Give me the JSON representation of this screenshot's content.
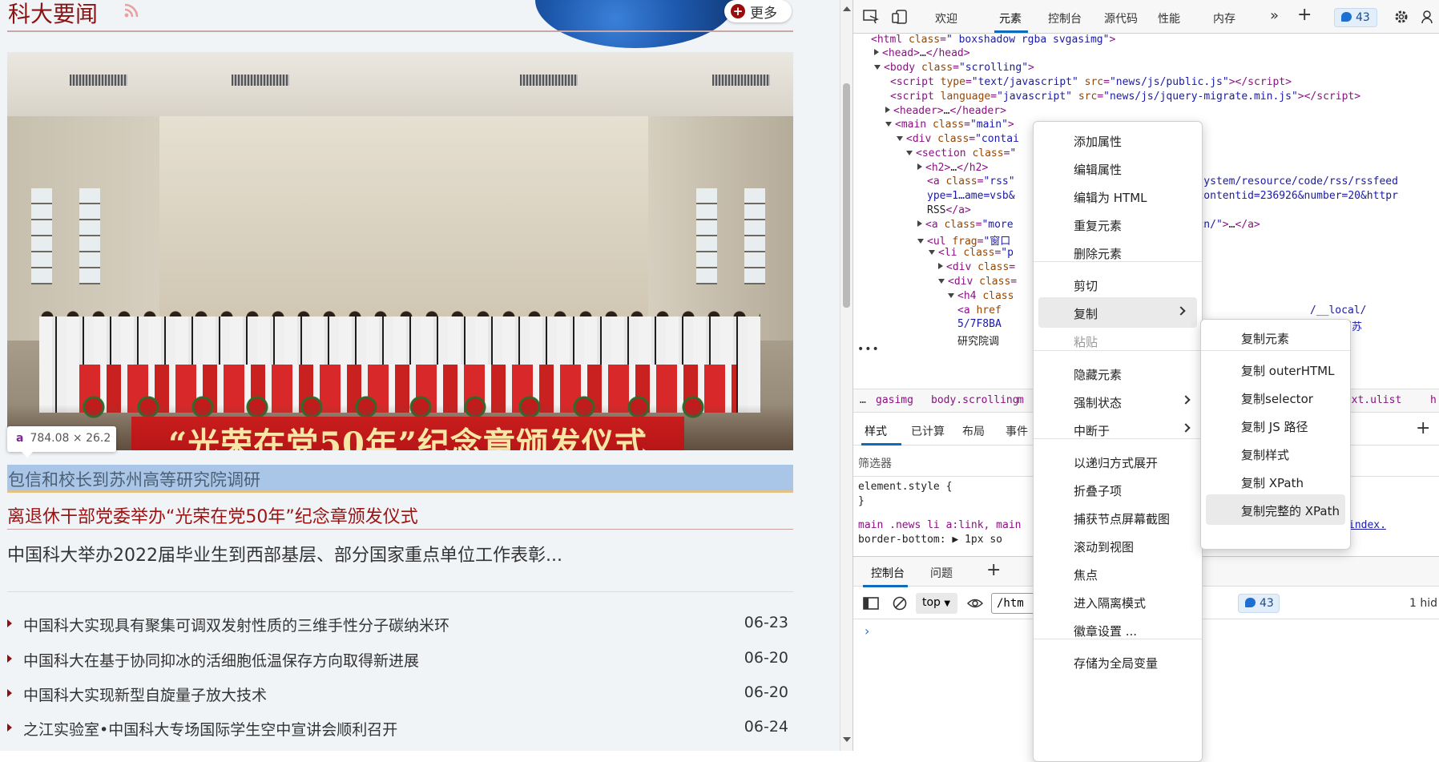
{
  "page": {
    "section_title": "科大要闻",
    "more_label": "更多",
    "photo_banner": "“光荣在党50年”纪念章颁发仪式",
    "size_tip": {
      "tag": "a",
      "size": "784.08 × 26.2"
    },
    "highlight_link": "包信和校长到苏州高等研究院调研",
    "news_1": "离退休干部党委举办“光荣在党50年”纪念章颁发仪式",
    "news_2": "中国科大举办2022届毕业生到西部基层、部分国家重点单位工作表彰...",
    "list": [
      {
        "title": "中国科大实现具有聚集可调双发射性质的三维手性分子碳纳米环",
        "date": "06-23"
      },
      {
        "title": "中国科大在基于协同抑冰的活细胞低温保存方向取得新进展",
        "date": "06-20"
      },
      {
        "title": "中国科大实现新型自旋量子放大技术",
        "date": "06-20"
      },
      {
        "title": "之江实验室•中国科大专场国际学生空中宣讲会顺利召开",
        "date": "06-24"
      }
    ]
  },
  "devtools": {
    "tabs": [
      "欢迎",
      "元素",
      "控制台",
      "源代码",
      "性能",
      "内存"
    ],
    "issues_count": "43",
    "dom": [
      {
        "html": "<span class='tg'>&lt;html</span> <span class='at'>class</span>=<span class='vl'>\" boxshadow rgba svgasimg\"</span><span class='tg'>&gt;</span>"
      },
      {
        "html": "<span class='tri tri-r'></span><span class='tg'>&lt;head&gt;</span><span class='tx'>…</span><span class='tg'>&lt;/head&gt;</span>"
      },
      {
        "html": "<span class='tri tri-d'></span><span class='tg'>&lt;body</span> <span class='at'>class</span>=<span class='vl'>\"scrolling\"</span><span class='tg'>&gt;</span>"
      },
      {
        "html": "<span class='tg'>&lt;script</span> <span class='at'>type</span>=<span class='vl'>\"text/javascript\"</span> <span class='at'>src</span>=<span class='vl'>\"news/js/public.js\"</span><span class='tg'>&gt;&lt;/script&gt;</span>"
      },
      {
        "html": "<span class='tg'>&lt;script</span> <span class='at'>language</span>=<span class='vl'>\"javascript\"</span> <span class='at'>src</span>=<span class='vl'>\"news/js/jquery-migrate.min.js\"</span><span class='tg'>&gt;&lt;/script&gt;</span>"
      },
      {
        "html": "<span class='tri tri-r'></span><span class='tg'>&lt;header&gt;</span><span class='tx'>…</span><span class='tg'>&lt;/header&gt;</span>"
      },
      {
        "html": "<span class='tri tri-d'></span><span class='tg'>&lt;main</span> <span class='at'>class</span>=<span class='vl'>\"main\"</span><span class='tg'>&gt;</span>"
      },
      {
        "html": "<span class='tri tri-d'></span><span class='tg'>&lt;div</span> <span class='at'>class</span>=<span class='vl'>\"contai</span>"
      },
      {
        "html": "<span class='tri tri-d'></span><span class='tg'>&lt;section</span> <span class='at'>class</span>=<span class='vl'>\"</span>"
      },
      {
        "html": "<span class='tri tri-r'></span><span class='tg'>&lt;h2&gt;</span><span class='tx'>…</span><span class='tg'>&lt;/h2&gt;</span>"
      },
      {
        "html": "<span class='tg'>&lt;a</span> <span class='at'>class</span>=<span class='vl'>\"rss\"</span>"
      },
      {
        "html": "<span class='vl'>ype=1…ame=vsb&amp;</span>"
      },
      {
        "html": "<span class='tx'>RSS</span><span class='tg'>&lt;/a&gt;</span>"
      },
      {
        "html": "<span class='tri tri-r'></span><span class='tg'>&lt;a</span> <span class='at'>class</span>=<span class='vl'>\"more</span>"
      },
      {
        "html": "<span class='tri tri-d'></span><span class='tg'>&lt;ul</span> <span class='at'>frag</span>=<span class='vl'>\"窗口</span>"
      },
      {
        "html": "<span class='tri tri-d'></span><span class='tg'>&lt;li</span> <span class='at'>class</span>=<span class='vl'>\"p</span>"
      },
      {
        "html": "<span class='tri tri-r'></span><span class='tg'>&lt;div</span> <span class='at'>class</span>="
      },
      {
        "html": "<span class='tri tri-d'></span><span class='tg'>&lt;div</span> <span class='at'>class</span>="
      },
      {
        "html": "<span class='tri tri-d'></span><span class='tg'>&lt;h4</span> <span class='at'>class</span>"
      },
      {
        "html": "<span class='tg'>&lt;a</span> <span class='at'>href</span>"
      },
      {
        "html": "<span class='vl'>5/7F8BA</span>"
      },
      {
        "html": "<span class='tx'>研究院调</span>"
      }
    ],
    "dom_right": [
      {
        "html": "<span class='vl'>cn/system/resource/code/rss/rssfeed</span>"
      },
      {
        "html": "<span class='vl'>zz&amp;contentid=236926&amp;number=20&amp;httpr</span>"
      },
      {
        "html": "<span class='vl'>du.cn/\"</span><span class='tg'>&gt;</span><span class='tx'>…</span><span class='tg'>&lt;/a&gt;</span>"
      },
      {
        "html": "<span class='tg'>&gt;</span>"
      },
      {
        "html": "<span class='vl'>/__local/</span>"
      },
      {
        "html": "<span class='vl'>和校长到苏</span>"
      }
    ],
    "breadcrumbs": [
      "gasimg",
      "body.scrolling",
      "m",
      ".txt.ulist",
      "h"
    ],
    "style_tabs": [
      "样式",
      "已计算",
      "布局",
      "事件"
    ],
    "filter_placeholder": "筛选器",
    "styles": [
      "element.style {",
      "}",
      "main .news li a:link, main",
      "  border-bottom: ▶ 1px so",
      "index."
    ],
    "console_tabs": [
      "控制台",
      "问题"
    ],
    "console_context": "top",
    "console_filter": "/htm",
    "console_issues": "43",
    "console_hidden": "1 hid"
  },
  "context_menu": {
    "items": [
      {
        "label": "添加属性"
      },
      {
        "label": "编辑属性"
      },
      {
        "label": "编辑为 HTML"
      },
      {
        "label": "重复元素"
      },
      {
        "label": "删除元素"
      },
      {
        "label": "剪切"
      },
      {
        "label": "复制",
        "sub": true,
        "selected": true
      },
      {
        "label": "粘贴",
        "disabled": true
      },
      {
        "label": "隐藏元素"
      },
      {
        "label": "强制状态",
        "sub": true
      },
      {
        "label": "中断于",
        "sub": true
      },
      {
        "label": "以递归方式展开"
      },
      {
        "label": "折叠子项"
      },
      {
        "label": "捕获节点屏幕截图"
      },
      {
        "label": "滚动到视图"
      },
      {
        "label": "焦点"
      },
      {
        "label": "进入隔离模式"
      },
      {
        "label": "徽章设置 ..."
      },
      {
        "label": "存储为全局变量"
      }
    ],
    "submenu": [
      "复制元素",
      "复制 outerHTML",
      "复制selector",
      "复制 JS 路径",
      "复制样式",
      "复制 XPath",
      "复制完整的 XPath"
    ]
  }
}
